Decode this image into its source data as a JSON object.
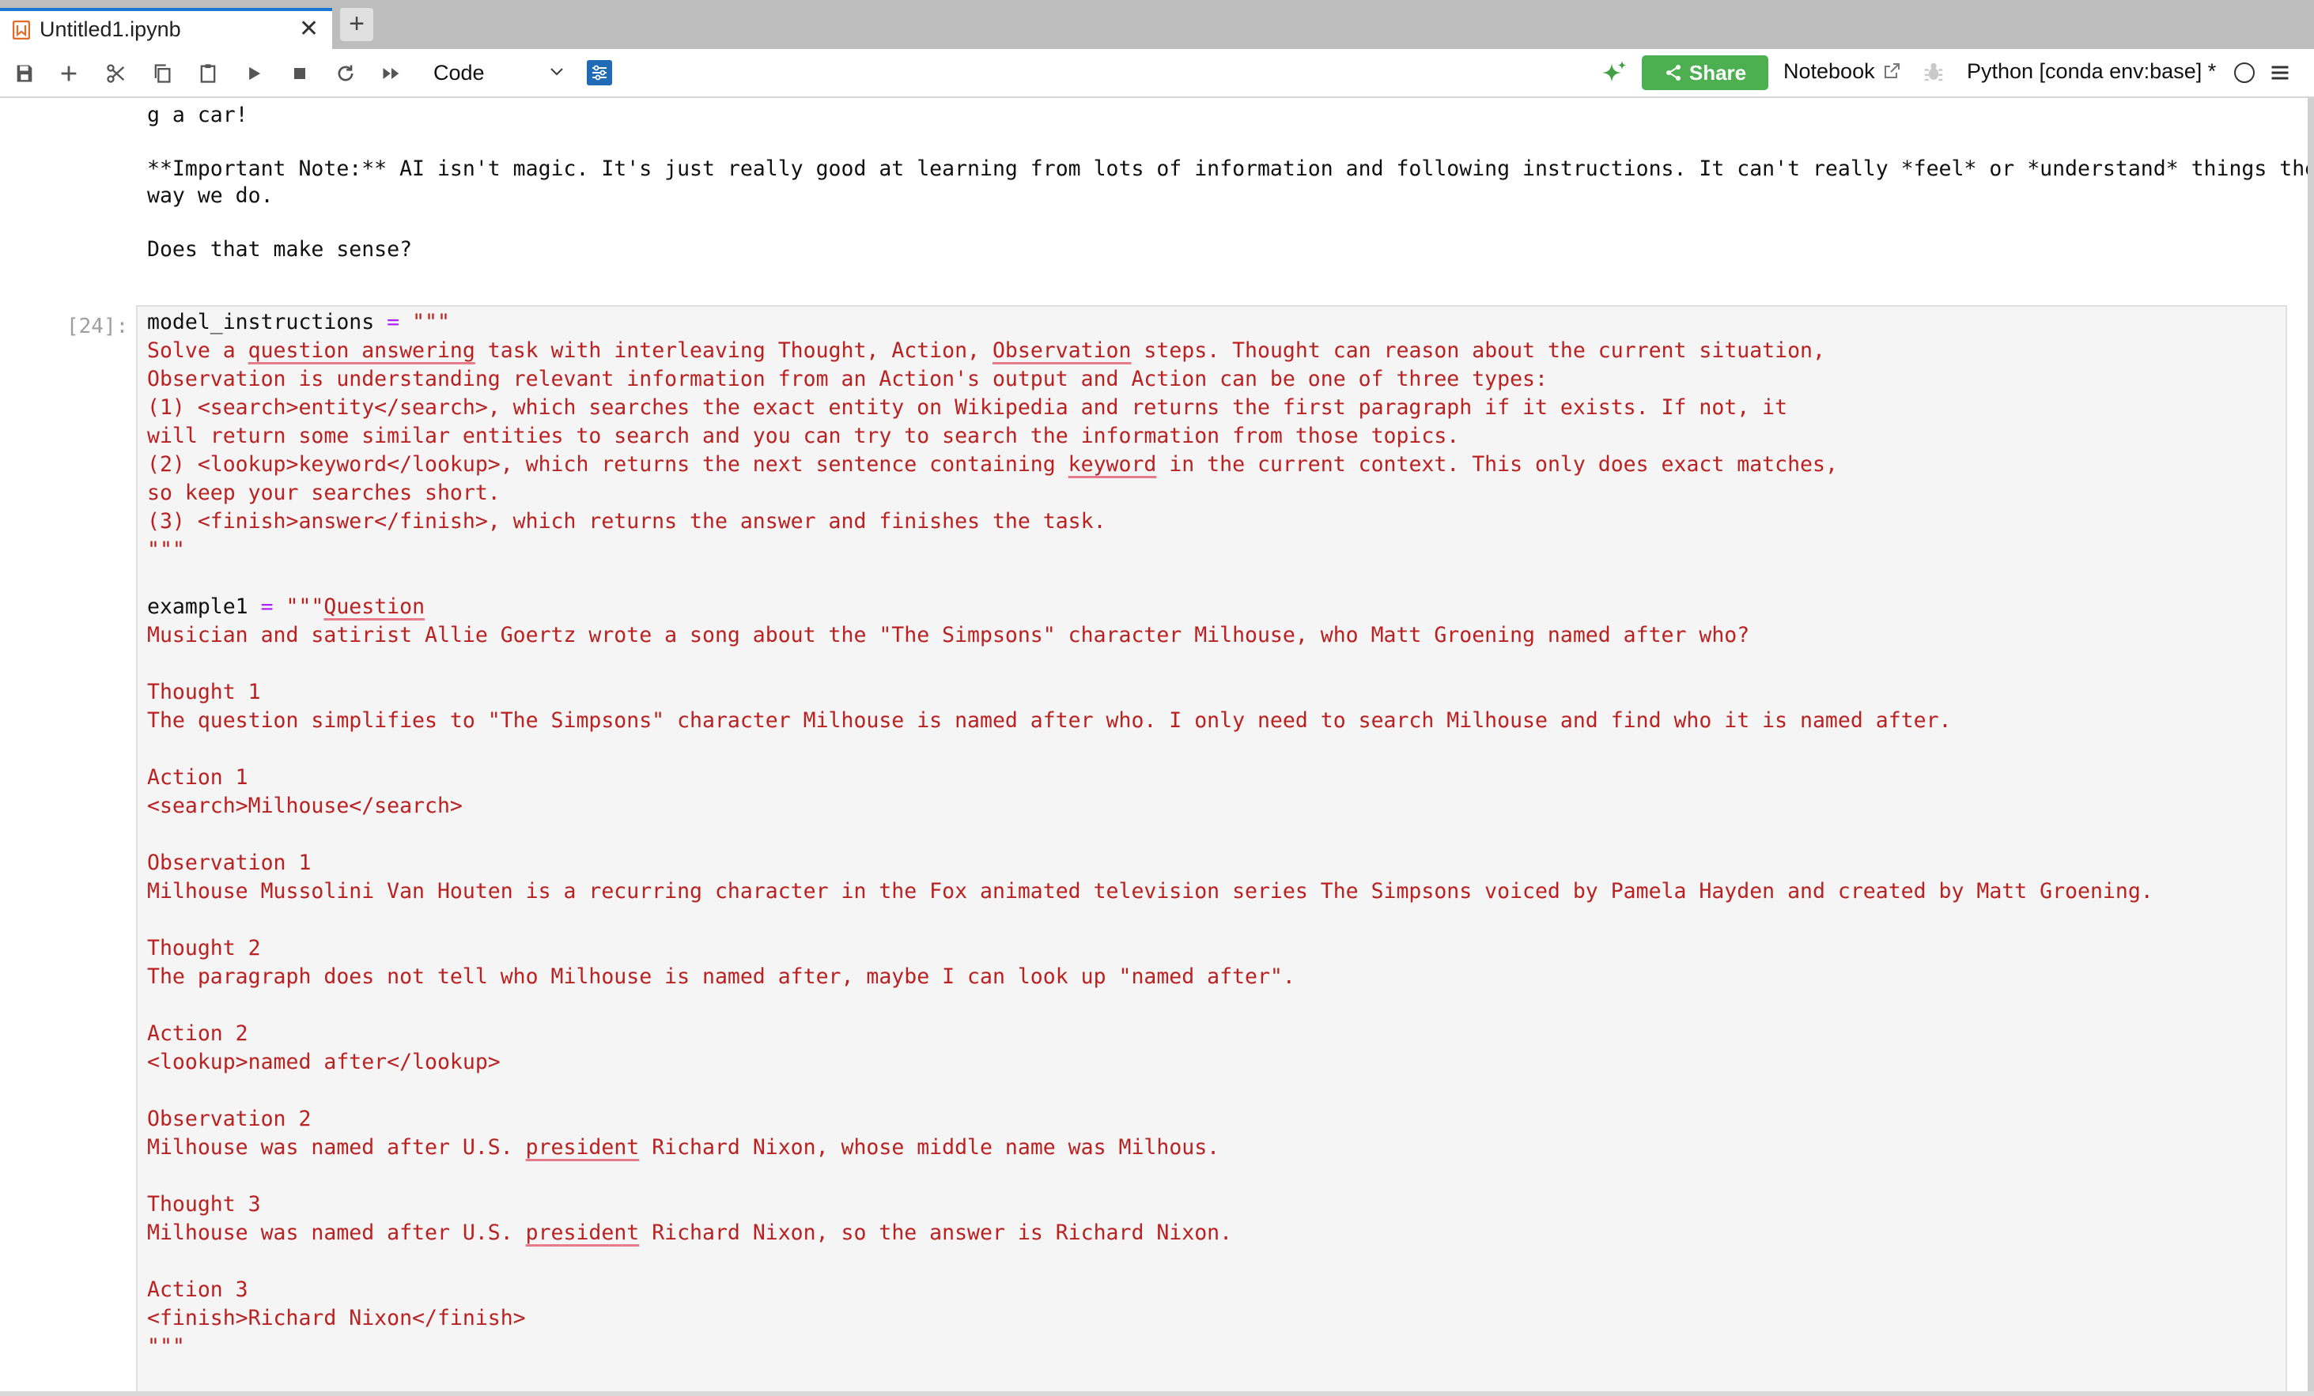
{
  "tab": {
    "title": "Untitled1.ipynb",
    "close": "✕",
    "add": "+"
  },
  "toolbar": {
    "cell_type": "Code",
    "share_label": "Share",
    "notebook_label": "Notebook",
    "kernel_label": "Python [conda env:base] *"
  },
  "markdown_lines": [
    "g a car!",
    "",
    "**Important Note:** AI isn't magic. It's just really good at learning from lots of information and following instructions. It can't really *feel* or *understand* things the",
    "way we do.",
    "",
    "Does that make sense?"
  ],
  "code_cell": {
    "prompt": "[24]:",
    "line_1_var": "model_instructions",
    "line_1_op": " = ",
    "line_1_str": "\"\"\"",
    "instr_1a": "Solve a ",
    "instr_1b": "question answering",
    "instr_1c": " task with interleaving Thought, Action, ",
    "instr_1d": "Observation",
    "instr_1e": " steps. Thought can reason about the current situation,",
    "instr_2": "Observation is understanding relevant information from an Action's output and Action can be one of three types:",
    "instr_3": "(1) <search>entity</search>, which searches the exact entity on Wikipedia and returns the first paragraph if it exists. If not, it",
    "instr_4": "will return some similar entities to search and you can try to search the information from those topics.",
    "instr_5a": "(2) <lookup>keyword</lookup>, which returns the next sentence containing ",
    "instr_5b": "keyword",
    "instr_5c": " in the current context. This only does exact matches,",
    "instr_6": "so keep your searches short.",
    "instr_7": "(3) <finish>answer</finish>, which returns the answer and finishes the task.",
    "instr_end": "\"\"\"",
    "ex_var": "example1",
    "ex_op": " = ",
    "ex_q1": "\"\"\"",
    "ex_q2": "Question",
    "question": "Musician and satirist Allie Goertz wrote a song about the \"The Simpsons\" character Milhouse, who Matt Groening named after who?",
    "thought1_h": "Thought 1",
    "thought1": "The question simplifies to \"The Simpsons\" character Milhouse is named after who. I only need to search Milhouse and find who it is named after.",
    "action1_h": "Action 1",
    "action1": "<search>Milhouse</search>",
    "obs1_h": "Observation 1",
    "obs1": "Milhouse Mussolini Van Houten is a recurring character in the Fox animated television series The Simpsons voiced by Pamela Hayden and created by Matt Groening.",
    "thought2_h": "Thought 2",
    "thought2": "The paragraph does not tell who Milhouse is named after, maybe I can look up \"named after\".",
    "action2_h": "Action 2",
    "action2": "<lookup>named after</lookup>",
    "obs2_h": "Observation 2",
    "obs2a": "Milhouse was named after U.S. ",
    "obs2b": "president",
    "obs2c": " Richard Nixon, whose middle name was Milhous.",
    "thought3_h": "Thought 3",
    "thought3a": "Milhouse was named after U.S. ",
    "thought3b": "president",
    "thought3c": " Richard Nixon, so the answer is Richard Nixon.",
    "action3_h": "Action 3",
    "action3": "<finish>Richard Nixon</finish>",
    "ex_end": "\"\"\""
  },
  "icons": {
    "toolbar": [
      "save-icon",
      "add-cell-icon",
      "cut-icon",
      "copy-icon",
      "paste-icon",
      "run-icon",
      "stop-icon",
      "restart-icon",
      "fast-forward-icon"
    ],
    "accent": "#1976d2",
    "share_green": "#4caf50",
    "string_red": "#ba2121",
    "operator_purple": "#aa22ff"
  }
}
